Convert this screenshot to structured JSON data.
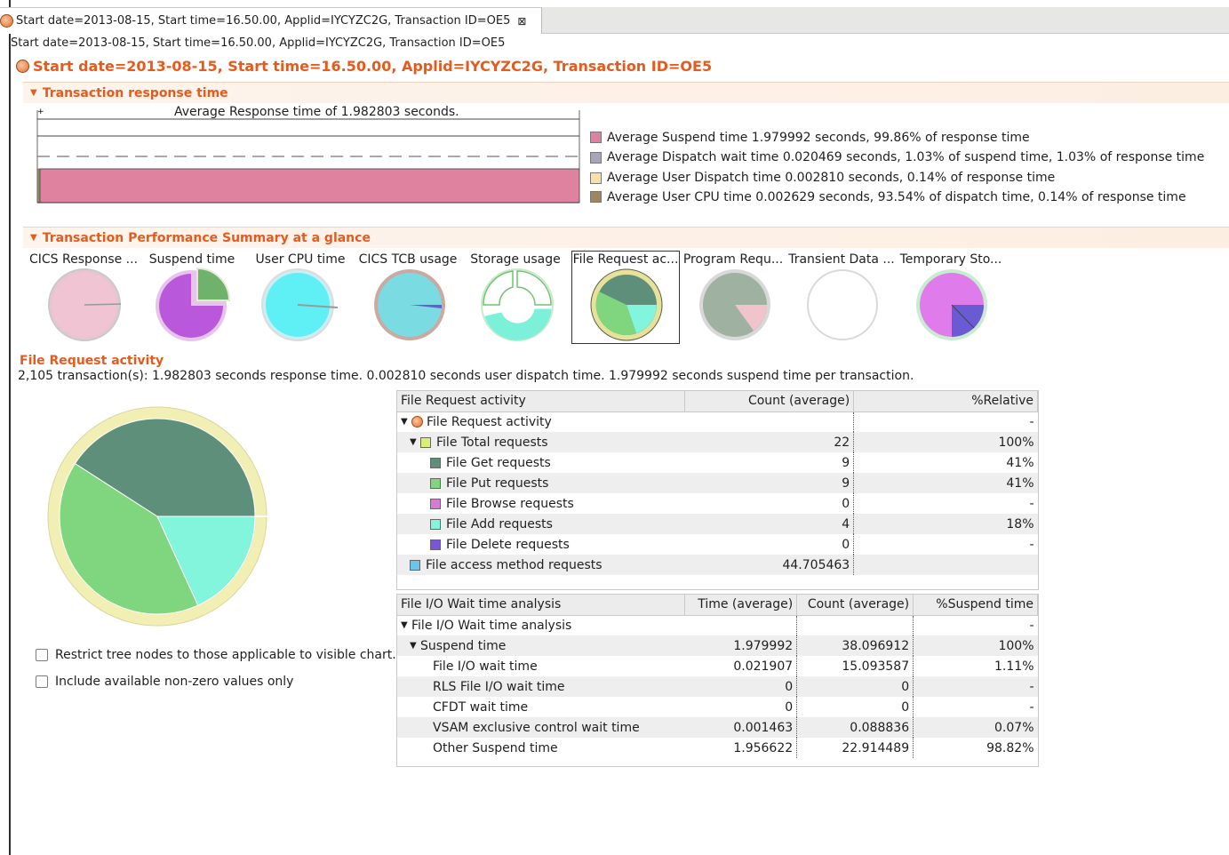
{
  "tab": {
    "title": "Start date=2013-08-15, Start time=16.50.00, Applid=IYCYZC2G, Transaction ID=OE5",
    "close_glyph": "⊠"
  },
  "subtitle": "Start date=2013-08-15, Start time=16.50.00, Applid=IYCYZC2G, Transaction ID=OE5",
  "main_title": "Start date=2013-08-15, Start time=16.50.00, Applid=IYCYZC2G, Transaction ID=OE5",
  "sections": {
    "response": "Transaction response time",
    "summary": "Transaction Performance Summary at a glance"
  },
  "response_chart": {
    "caption": "Average Response time of 1.982803 seconds.",
    "legend": [
      {
        "text": "Average Suspend time 1.979992 seconds, 99.86% of response time",
        "color": "#df829f"
      },
      {
        "text": "Average Dispatch wait time 0.020469 seconds, 1.03% of suspend time, 1.03% of response time",
        "color": "#a6a6b8"
      },
      {
        "text": "Average User Dispatch time 0.002810 seconds, 0.14% of response time",
        "color": "#f8e0a8"
      },
      {
        "text": "Average User CPU time 0.002629 seconds, 93.54% of dispatch time, 0.14% of response time",
        "color": "#a08660"
      }
    ],
    "suspend_fraction": 0.9986
  },
  "thumbnails": [
    {
      "label": "CICS Response ...",
      "icon": "pie-cics-response"
    },
    {
      "label": "Suspend time",
      "icon": "pie-suspend"
    },
    {
      "label": "User CPU time",
      "icon": "pie-user-cpu"
    },
    {
      "label": "CICS TCB usage",
      "icon": "pie-tcb"
    },
    {
      "label": "Storage usage",
      "icon": "pie-storage"
    },
    {
      "label": "File Request ac...",
      "icon": "pie-file-request",
      "selected": true
    },
    {
      "label": "Program Requ...",
      "icon": "pie-program"
    },
    {
      "label": "Transient Data ...",
      "icon": "pie-transient"
    },
    {
      "label": "Temporary Sto...",
      "icon": "pie-temporary"
    }
  ],
  "detail": {
    "title": "File Request activity",
    "description": "2,105 transaction(s): 1.982803 seconds response time. 0.002810 seconds user dispatch time. 1.979992 seconds suspend time per transaction."
  },
  "checkboxes": {
    "restrict": "Restrict tree nodes to those applicable to visible chart.",
    "nonzero": "Include available non-zero values only"
  },
  "file_table": {
    "headers": [
      "File Request activity",
      "Count (average)",
      "%Relative"
    ],
    "rows": [
      {
        "label": "File Request activity",
        "count": "",
        "rel": "-",
        "color": ""
      },
      {
        "label": "File Total requests",
        "count": "22",
        "rel": "100%",
        "color": "#d8f07a"
      },
      {
        "label": "File Get requests",
        "count": "9",
        "rel": "41%",
        "color": "#5e8f7a"
      },
      {
        "label": "File Put requests",
        "count": "9",
        "rel": "41%",
        "color": "#7fd67e"
      },
      {
        "label": "File Browse requests",
        "count": "0",
        "rel": "-",
        "color": "#d67ad6"
      },
      {
        "label": "File Add requests",
        "count": "4",
        "rel": "18%",
        "color": "#82f5dc"
      },
      {
        "label": "File Delete requests",
        "count": "0",
        "rel": "-",
        "color": "#7b55d9"
      },
      {
        "label": "File access method requests",
        "count": "44.705463",
        "rel": "",
        "color": "#6ec3ec"
      }
    ]
  },
  "wait_table": {
    "headers": [
      "File I/O Wait time analysis",
      "Time (average)",
      "Count (average)",
      "%Suspend time"
    ],
    "rows": [
      {
        "label": "File I/O Wait time analysis",
        "time": "",
        "count": "",
        "pct": "-"
      },
      {
        "label": "Suspend time",
        "time": "1.979992",
        "count": "38.096912",
        "pct": "100%"
      },
      {
        "label": "File I/O wait time",
        "time": "0.021907",
        "count": "15.093587",
        "pct": "1.11%"
      },
      {
        "label": "RLS File I/O wait time",
        "time": "0",
        "count": "0",
        "pct": "-"
      },
      {
        "label": "CFDT wait time",
        "time": "0",
        "count": "0",
        "pct": "-"
      },
      {
        "label": "VSAM exclusive control wait time",
        "time": "0.001463",
        "count": "0.088836",
        "pct": "0.07%"
      },
      {
        "label": "Other Suspend time",
        "time": "1.956622",
        "count": "22.914489",
        "pct": "98.82%"
      }
    ]
  },
  "big_pie": {
    "slices": [
      {
        "name": "File Get requests",
        "value": 9,
        "color": "#5e8f7a"
      },
      {
        "name": "File Put requests",
        "value": 9,
        "color": "#7fd67e"
      },
      {
        "name": "File Add requests",
        "value": 4,
        "color": "#82f5dc"
      }
    ],
    "ring_color": "#f2efb5"
  }
}
